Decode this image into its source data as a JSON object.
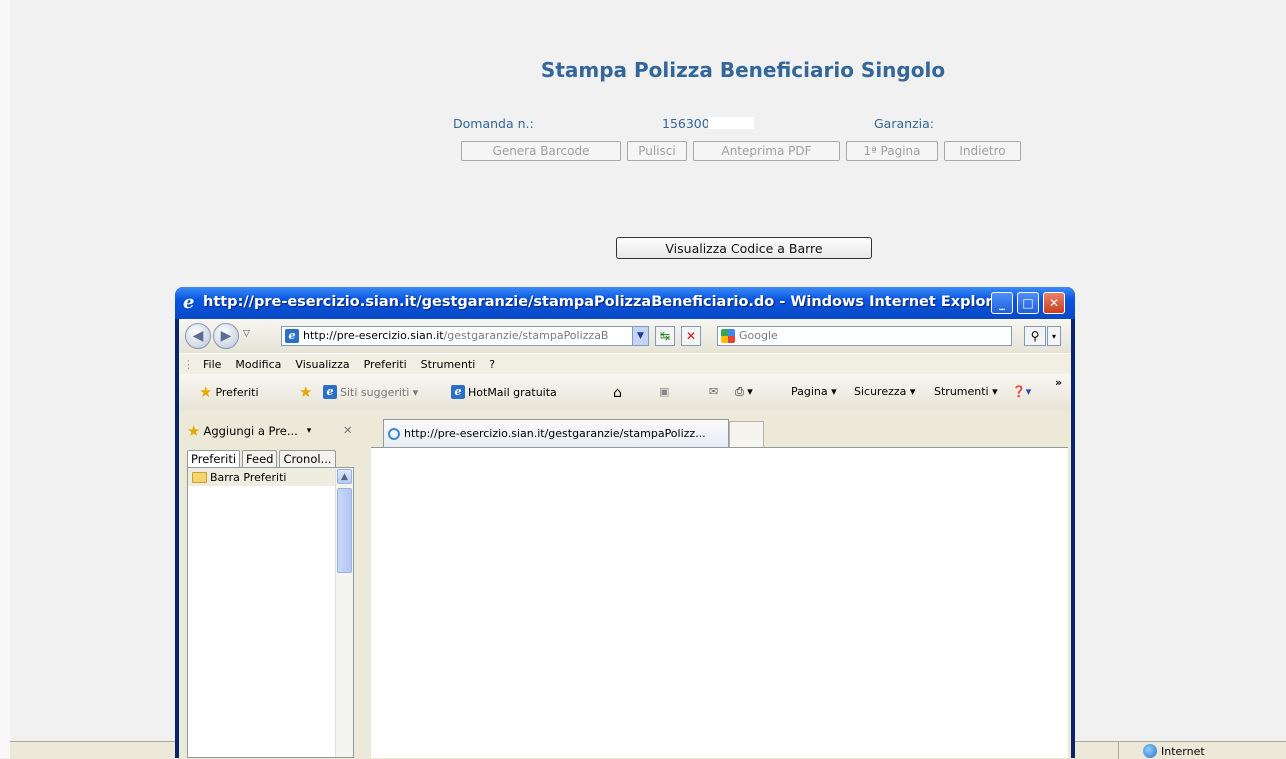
{
  "page": {
    "title": "Stampa Polizza Beneficiario Singolo",
    "domanda_label": "Domanda n.:",
    "domanda_value": "1563000",
    "garanzia_label": "Garanzia:",
    "buttons": [
      "Genera Barcode",
      "Pulisci",
      "Anteprima PDF",
      "1ª Pagina",
      "Indietro"
    ],
    "visualizza_button": "Visualizza Codice a Barre",
    "status_zone": "Internet"
  },
  "ie": {
    "window_title": "http://pre-esercizio.sian.it/gestgaranzie/stampaPolizzaBeneficiario.do - Windows Internet Explorer",
    "address_host": "http://pre-esercizio.sian.it",
    "address_path": "/gestgaranzie/stampaPolizzaB",
    "search_placeholder": "Google",
    "menu": [
      "File",
      "Modifica",
      "Visualizza",
      "Preferiti",
      "Strumenti",
      "?"
    ],
    "favbar": {
      "preferiti": "Preferiti",
      "siti_suggeriti": "Siti suggeriti ▾",
      "hotmail": "HotMail gratuita",
      "pagina": "Pagina ▾",
      "sicurezza": "Sicurezza ▾",
      "strumenti": "Strumenti ▾"
    },
    "sidebar": {
      "add_label": "Aggiungi a Pre...",
      "tabs": [
        "Preferiti",
        "Feed",
        "Cronol..."
      ],
      "items": [
        "Barra Preferiti"
      ]
    },
    "tab_title": "http://pre-esercizio.sian.it/gestgaranzie/stampaPolizz..."
  }
}
